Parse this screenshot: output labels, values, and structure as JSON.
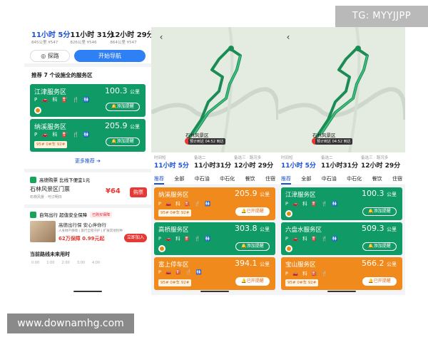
{
  "watermark_top": "TG: MYYJJPP",
  "watermark_bottom": "www.downamhg.com",
  "panel1": {
    "routes": [
      {
        "time": "11小时 5分",
        "sub": "845公里 ¥547"
      },
      {
        "time": "11小时 31分",
        "sub": "826公里 ¥546"
      },
      {
        "time": "12小时 29分",
        "sub": "864公里 ¥547"
      }
    ],
    "explore_label": "探路",
    "start_nav_label": "开始导航",
    "rec_title": "推荐 7 个设施全的服务区",
    "service_areas": [
      {
        "name": "江津服务区",
        "dist": "100.3",
        "unit": "公里",
        "icons": "P 🚗 科 ⛽ 🍴 🚻",
        "alert": "添加提醒"
      },
      {
        "name": "纳溪服务区",
        "dist": "205.9",
        "unit": "公里",
        "icons": "P 🚗 科 ⛽ 🍴 🚻",
        "fuel": "95# 0#车 92#",
        "alert": "添加提醒"
      }
    ],
    "more_label": "更多推荐",
    "ticket_header": "高德购票 比线下便宜1元",
    "ticket_name": "石林风景区门票",
    "ticket_sub": "石林风景 · 可订明日",
    "ticket_price": "¥64",
    "buy_label": "购票",
    "insurance_header": "自驾出行 超值安全保障",
    "insurance_badge": "已购买保障",
    "insurance_title": "高德出行保 安心伴你行",
    "insurance_sub": "人身财产保障 | 旅行全程守护 | 扩展其他险种",
    "insurance_price": "62万保障 0.99元起",
    "join_label": "立即加入",
    "future_title": "当前路线未来用时",
    "timeline": [
      "0:00",
      "1:00",
      "2:00",
      "3:00",
      "4:00"
    ]
  },
  "panel2": {
    "dest": "石林风景区",
    "dest_sub": "预计到达 04:52 到达",
    "route_tabs": [
      {
        "label": "时间短",
        "time": "11小时 5分"
      },
      {
        "label": "备选二",
        "time": "11小时31分"
      },
      {
        "label": "备选三 · 路况多",
        "time": "12小时 29分"
      }
    ],
    "cats": [
      "推荐",
      "全部",
      "中石油",
      "中石化",
      "餐饮",
      "住宿"
    ],
    "partial": {
      "name": "纳溪服务区",
      "dist": "205.9"
    },
    "service_areas": [
      {
        "name": "纳溪服务区",
        "dist": "205.9",
        "unit": "公里",
        "icons": "P 🚗 科 ⛽ 🍴 🚻",
        "fuel": "95# 0#车 92#",
        "alert": "已开提醒",
        "color": "orange"
      },
      {
        "name": "高桥服务区",
        "dist": "303.8",
        "unit": "公里",
        "icons": "P 🚗 科 ⛽ 🍴 🚻",
        "alert": "添加提醒",
        "color": "green"
      },
      {
        "name": "富上停车区",
        "dist": "394.1",
        "unit": "公里",
        "icons": "P 🚗 ⛽ 🍴 🚻",
        "fuel": "95# 0#车 92#",
        "alert": "已开提醒",
        "color": "orange"
      }
    ]
  },
  "panel3": {
    "dest": "石林风景区",
    "dest_sub": "预计到达 04:52 到达",
    "route_tabs": [
      {
        "label": "时间短",
        "time": "11小时 5分"
      },
      {
        "label": "备选二",
        "time": "11小时31分"
      },
      {
        "label": "备选三 · 路况多",
        "time": "12小时 29分"
      }
    ],
    "cats": [
      "推荐",
      "全部",
      "中石油",
      "中石化",
      "餐饮",
      "住宿"
    ],
    "service_areas": [
      {
        "name": "江津服务区",
        "dist": "100.3",
        "unit": "公里",
        "icons": "P 🚗 科 ⛽ 🍴 🚻",
        "alert": "添加提醒",
        "color": "green"
      },
      {
        "name": "六盘水服务区",
        "dist": "509.3",
        "unit": "公里",
        "icons": "P 🚗 科 ⛽ 🍴 🚻",
        "alert": "添加提醒",
        "color": "green"
      },
      {
        "name": "宝山服务区",
        "dist": "566.2",
        "unit": "公里",
        "icons": "P 🚗 科 ⛽ 🍴",
        "fuel": "95# 0#车 92#",
        "alert": "已开提醒",
        "color": "orange"
      }
    ]
  },
  "colors": {
    "green": "#0f9a66",
    "orange": "#f08a1c",
    "blue": "#2f7ff5",
    "red": "#e53935"
  }
}
